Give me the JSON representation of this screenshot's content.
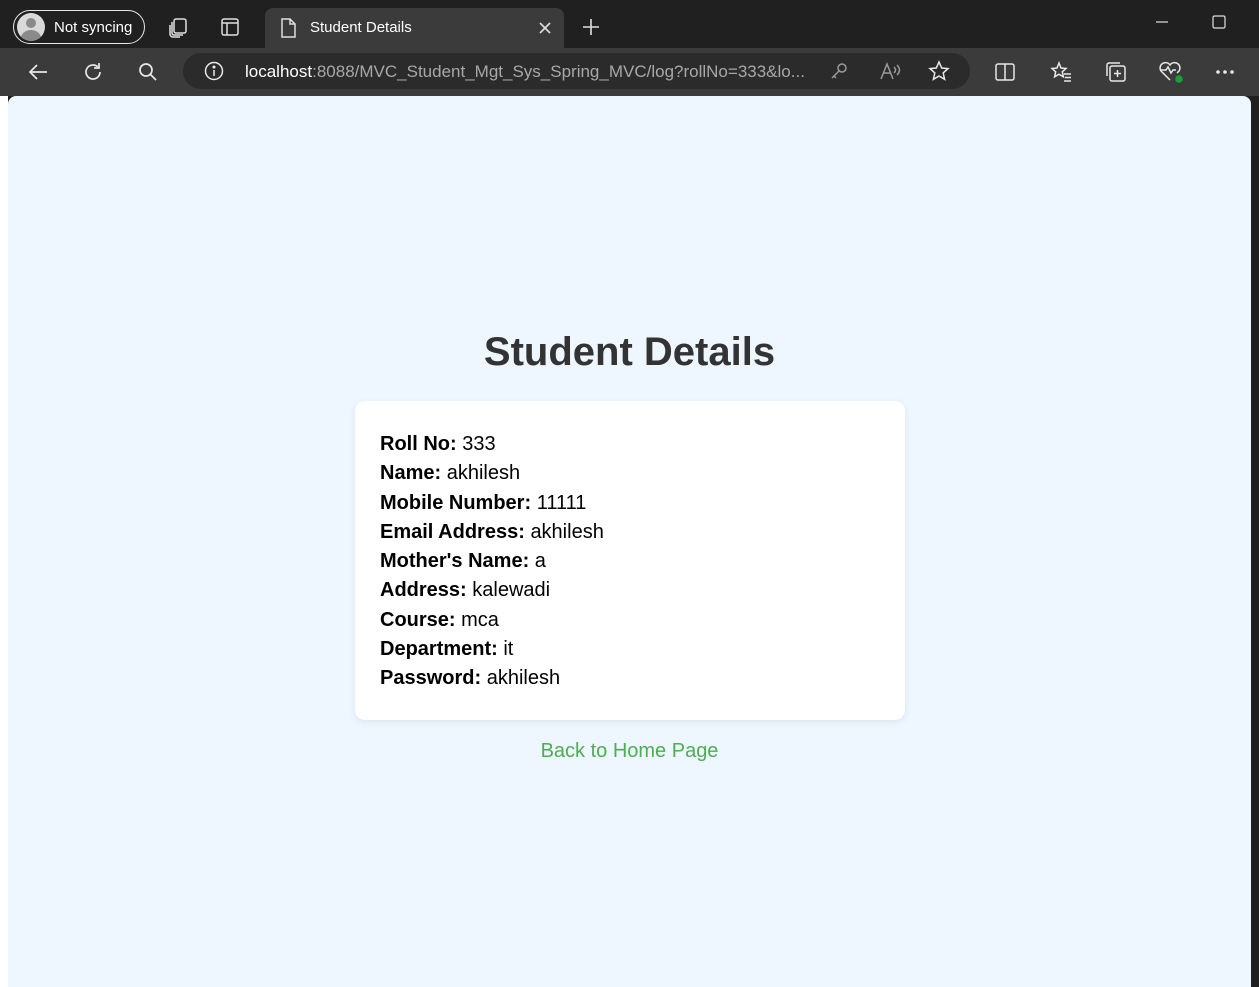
{
  "browser": {
    "profile_label": "Not syncing",
    "tab_title": "Student Details",
    "url_host": "localhost",
    "url_rest": ":8088/MVC_Student_Mgt_Sys_Spring_MVC/log?rollNo=333&lo...",
    "colors": {
      "frame": "#202020",
      "toolbar": "#3b3b3b",
      "address": "#2b2b2b"
    }
  },
  "page": {
    "title": "Student Details",
    "background": "#eef6ff",
    "details": [
      {
        "label": "Roll No:",
        "value": "333"
      },
      {
        "label": "Name:",
        "value": "akhilesh"
      },
      {
        "label": "Mobile Number:",
        "value": "11111"
      },
      {
        "label": "Email Address:",
        "value": "akhilesh"
      },
      {
        "label": "Mother's Name:",
        "value": "a"
      },
      {
        "label": "Address:",
        "value": "kalewadi"
      },
      {
        "label": "Course:",
        "value": "mca"
      },
      {
        "label": "Department:",
        "value": "it"
      },
      {
        "label": "Password:",
        "value": "akhilesh"
      }
    ],
    "back_link": "Back to Home Page",
    "link_color": "#4caf50"
  }
}
